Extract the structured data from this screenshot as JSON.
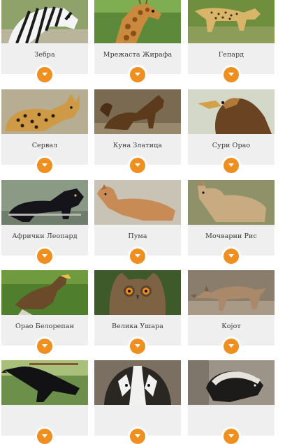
{
  "colors": {
    "accent": "#ee8f1f",
    "panel": "#efefef",
    "text": "#3a3a3a"
  },
  "animals": [
    {
      "name": "Зебра",
      "icon": "chevron-down-icon"
    },
    {
      "name": "Мрежаста Жирафа",
      "icon": "chevron-down-icon"
    },
    {
      "name": "Гепард",
      "icon": "chevron-down-icon"
    },
    {
      "name": "Сервал",
      "icon": "chevron-down-icon"
    },
    {
      "name": "Куна Златица",
      "icon": "chevron-down-icon"
    },
    {
      "name": "Сури Орао",
      "icon": "chevron-down-icon"
    },
    {
      "name": "Афрички Леопард",
      "icon": "chevron-down-icon"
    },
    {
      "name": "Пума",
      "icon": "chevron-down-icon"
    },
    {
      "name": "Мочварни Рис",
      "icon": "chevron-down-icon"
    },
    {
      "name": "Орао Белорепан",
      "icon": "chevron-down-icon"
    },
    {
      "name": "Велика Ушара",
      "icon": "chevron-down-icon"
    },
    {
      "name": "Којот",
      "icon": "chevron-down-icon"
    },
    {
      "name": "",
      "icon": "chevron-down-icon"
    },
    {
      "name": "",
      "icon": "chevron-down-icon"
    },
    {
      "name": "",
      "icon": "chevron-down-icon"
    }
  ]
}
